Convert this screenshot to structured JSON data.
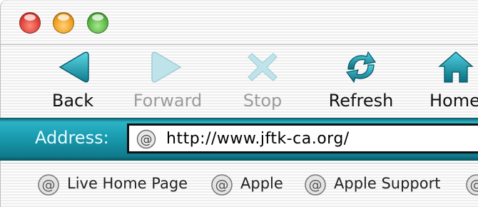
{
  "window": {
    "traffic_lights": [
      {
        "name": "close",
        "color": "#e0443a"
      },
      {
        "name": "minimize",
        "color": "#f0a020"
      },
      {
        "name": "zoom",
        "color": "#5cb845"
      }
    ]
  },
  "toolbar": {
    "back": {
      "label": "Back",
      "icon": "back-arrow-icon",
      "enabled": true
    },
    "forward": {
      "label": "Forward",
      "icon": "forward-arrow-icon",
      "enabled": false
    },
    "stop": {
      "label": "Stop",
      "icon": "stop-x-icon",
      "enabled": false
    },
    "refresh": {
      "label": "Refresh",
      "icon": "refresh-arrows-icon",
      "enabled": true
    },
    "home": {
      "label": "Home",
      "icon": "house-icon",
      "enabled": true
    }
  },
  "address_bar": {
    "label": "Address:",
    "url": "http://www.jftk-ca.org/",
    "icon": "at-sign-icon"
  },
  "favorites": [
    {
      "label": "Live Home Page",
      "icon": "at-sign-icon"
    },
    {
      "label": "Apple",
      "icon": "at-sign-icon"
    },
    {
      "label": "Apple Support",
      "icon": "at-sign-icon"
    }
  ],
  "colors": {
    "accent_teal": "#1a9aae",
    "icon_teal": "#16a3b5"
  }
}
